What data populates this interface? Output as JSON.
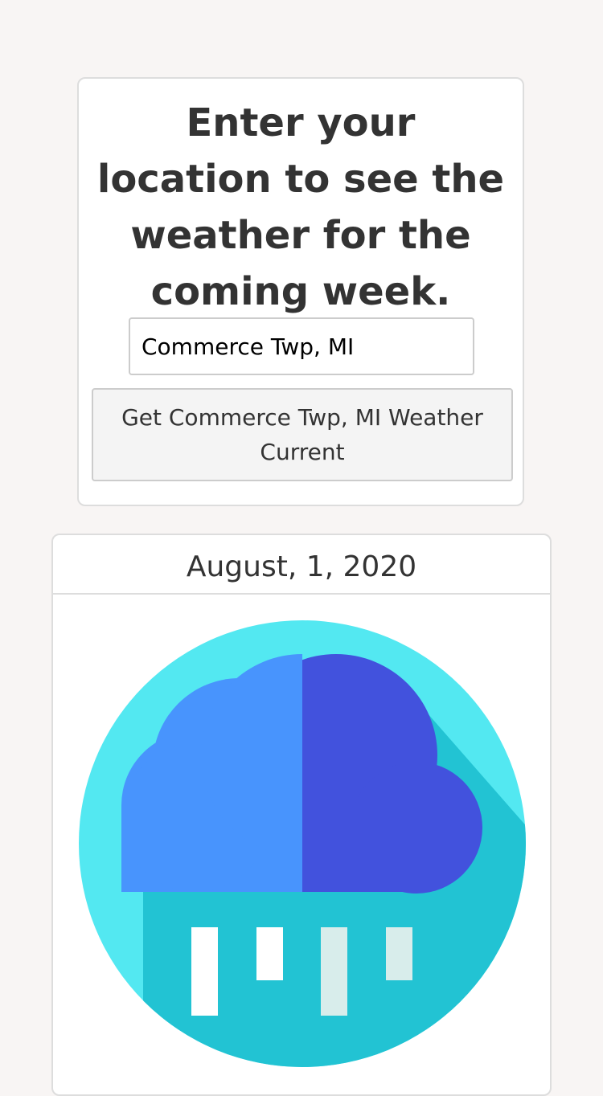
{
  "search": {
    "headline": "Enter your location to see the weather for the coming week.",
    "location_value": "Commerce Twp, MI",
    "button_label": "Get Commerce Twp, MI Weather Current"
  },
  "forecast": {
    "date": "August, 1, 2020",
    "icon": "rain-cloud-icon"
  },
  "colors": {
    "page_background": "#f8f5f4",
    "icon_circle": "#53e8f1",
    "icon_shadow": "#22c3d3",
    "cloud_light": "#4894fd",
    "cloud_dark": "#4252dd",
    "rain_white": "#ffffff",
    "rain_pale": "#d8edeb"
  }
}
